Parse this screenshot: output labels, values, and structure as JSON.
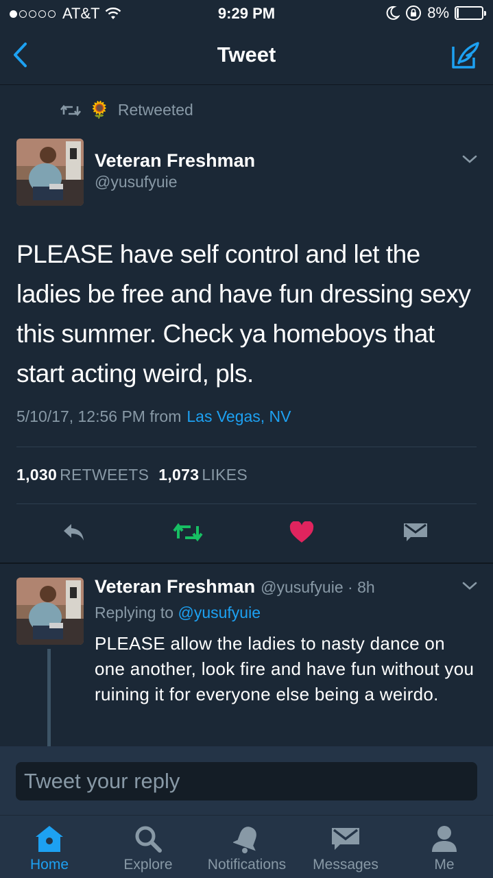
{
  "status_bar": {
    "carrier": "AT&T",
    "time": "9:29 PM",
    "battery": "8%",
    "battery_level": 0.08,
    "signal_bars": 1
  },
  "nav": {
    "title": "Tweet",
    "back_icon": "chevron-left-icon",
    "compose_icon": "compose-feather-icon"
  },
  "retweet_banner": {
    "emoji": "🌻",
    "label": "Retweeted"
  },
  "tweet": {
    "author_name": "Veteran Freshman",
    "author_handle": "@yusufyuie",
    "text": "PLEASE have self control and let the ladies be free and have fun dressing sexy this summer. Check ya homeboys that start acting weird, pls.",
    "timestamp": "5/10/17, 12:56 PM from",
    "location": "Las Vegas, NV",
    "retweet_count": "1,030",
    "retweet_label": "RETWEETS",
    "like_count": "1,073",
    "like_label": "LIKES"
  },
  "reply_tweet": {
    "author_name": "Veteran Freshman",
    "author_handle": "@yusufyuie",
    "age": "· 8h",
    "replying_prefix": "Replying to",
    "replying_to": "@yusufyuie",
    "text": "PLEASE allow the ladies to nasty dance on one another, look fire and have fun without you ruining it for everyone else being a weirdo."
  },
  "reply_input": {
    "placeholder": "Tweet your reply"
  },
  "tabs": [
    {
      "label": "Home",
      "icon": "home-icon",
      "active": true
    },
    {
      "label": "Explore",
      "icon": "search-icon",
      "active": false
    },
    {
      "label": "Notifications",
      "icon": "bell-icon",
      "active": false
    },
    {
      "label": "Messages",
      "icon": "envelope-icon",
      "active": false
    },
    {
      "label": "Me",
      "icon": "person-icon",
      "active": false
    }
  ],
  "colors": {
    "accent": "#1da1f2",
    "retweet_green": "#17bf63",
    "like_red": "#e0245e",
    "background": "#1b2836",
    "muted": "#8899a6"
  }
}
